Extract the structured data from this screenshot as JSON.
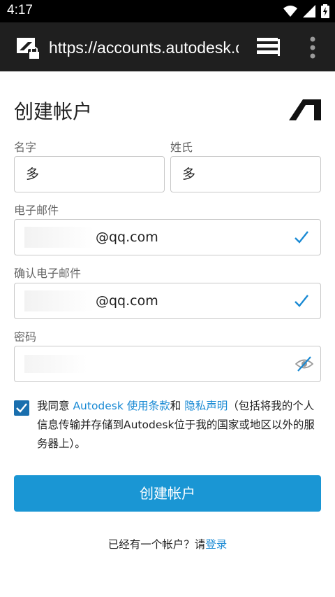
{
  "status_bar": {
    "time": "4:17",
    "icons": [
      "wifi-icon",
      "signal-icon",
      "battery-charging-icon"
    ]
  },
  "browser": {
    "url": "https://accounts.autodesk.com",
    "icons": [
      "lock-icon",
      "tabs-icon",
      "overflow-menu-icon"
    ]
  },
  "form": {
    "title": "创建帐户",
    "first_name": {
      "label": "名字",
      "value": "多"
    },
    "last_name": {
      "label": "姓氏",
      "value": "多"
    },
    "email": {
      "label": "电子邮件",
      "value_suffix": "@qq.com"
    },
    "confirm_email": {
      "label": "确认电子邮件",
      "value_suffix": "@qq.com"
    },
    "password": {
      "label": "密码"
    },
    "consent": {
      "checked": true,
      "part1": "我同意 ",
      "link_terms": "Autodesk 使用条款",
      "part2": "和 ",
      "link_privacy": "隐私声明",
      "part3": "（包括将我的个人信息传输并存储到Autodesk位于我的国家或地区以外的服务器上）。"
    },
    "submit_label": "创建帐户",
    "signin_prompt": "已经有一个帐户？请",
    "signin_link": "登录"
  },
  "colors": {
    "accent": "#1a96d4",
    "link": "#1a8ad4",
    "checkbox": "#1a6fae",
    "check_mark": "#1a8ad4"
  }
}
